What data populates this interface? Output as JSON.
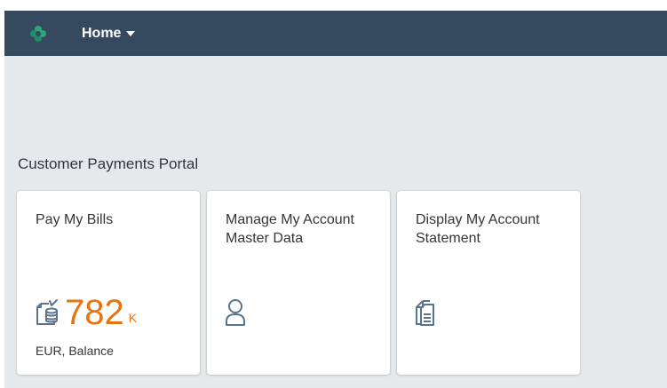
{
  "shell": {
    "home_label": "Home",
    "logo_icon": "company-logo-icon",
    "dropdown_icon": "caret-down-icon",
    "bar_color": "#354a5f"
  },
  "group": {
    "title": "Customer Payments Portal"
  },
  "tiles": [
    {
      "title": "Pay My Bills",
      "icon": "bills-icon",
      "kpi_value": "782",
      "kpi_scale": "K",
      "footer": "EUR, Balance",
      "kpi_color": "#e9730c"
    },
    {
      "title": "Manage My Account Master Data",
      "icon": "person-icon"
    },
    {
      "title": "Display My Account Statement",
      "icon": "documents-icon"
    }
  ]
}
